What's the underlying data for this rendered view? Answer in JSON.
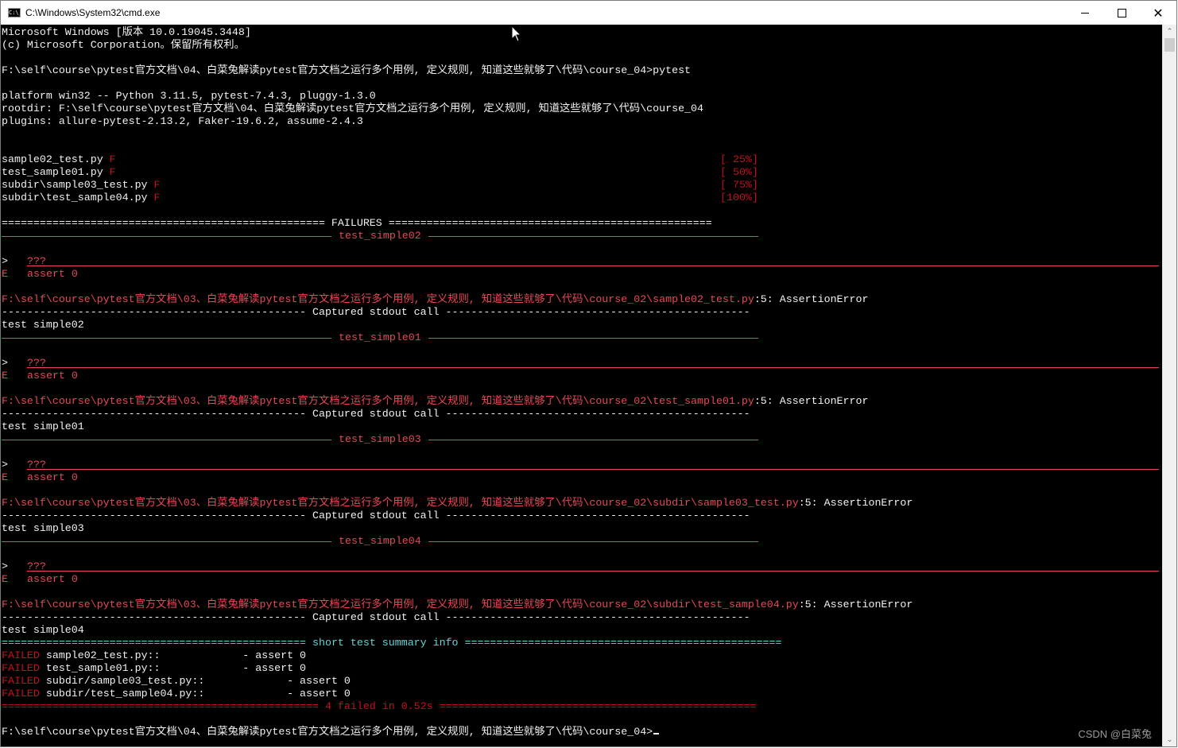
{
  "window": {
    "title": "C:\\Windows\\System32\\cmd.exe",
    "app_icon_text": "C:\\_",
    "controls": {
      "minimize": "minimize",
      "maximize": "maximize",
      "close": "✕"
    }
  },
  "console": {
    "header": [
      "Microsoft Windows [版本 10.0.19045.3448]",
      "(c) Microsoft Corporation。保留所有权利。"
    ],
    "prompt_command": "F:\\self\\course\\pytest官方文档\\04、白菜兔解读pytest官方文档之运行多个用例, 定义规则, 知道这些就够了\\代码\\course_04>pytest",
    "session_info": [
      "platform win32 -- Python 3.11.5, pytest-7.4.3, pluggy-1.3.0",
      "rootdir: F:\\self\\course\\pytest官方文档\\04、白菜兔解读pytest官方文档之运行多个用例, 定义规则, 知道这些就够了\\代码\\course_04",
      "plugins: allure-pytest-2.13.2, Faker-19.6.2, assume-2.4.3"
    ],
    "progress": [
      {
        "file": "sample02_test.py",
        "result": "F",
        "percent": "[ 25%]"
      },
      {
        "file": "test_sample01.py",
        "result": "F",
        "percent": "[ 50%]"
      },
      {
        "file": "subdir\\sample03_test.py",
        "result": "F",
        "percent": "[ 75%]"
      },
      {
        "file": "subdir\\test_sample04.py",
        "result": "F",
        "percent": "[100%]"
      }
    ],
    "failures_header": "=================================================== FAILURES ===================================================",
    "failures": [
      {
        "name": "test_simple02",
        "arrow": ">",
        "code": "???",
        "err_prefix": "E",
        "err": "assert 0",
        "location": "F:\\self\\course\\pytest官方文档\\03、白菜兔解读pytest官方文档之运行多个用例, 定义规则, 知道这些就够了\\代码\\course_02\\sample02_test.py",
        "location_suffix": ":5: AssertionError",
        "captured_header": "------------------------------------------------ Captured stdout call ------------------------------------------------",
        "stdout": "test simple02"
      },
      {
        "name": "test_simple01",
        "arrow": ">",
        "code": "???",
        "err_prefix": "E",
        "err": "assert 0",
        "location": "F:\\self\\course\\pytest官方文档\\03、白菜兔解读pytest官方文档之运行多个用例, 定义规则, 知道这些就够了\\代码\\course_02\\test_sample01.py",
        "location_suffix": ":5: AssertionError",
        "captured_header": "------------------------------------------------ Captured stdout call ------------------------------------------------",
        "stdout": "test simple01"
      },
      {
        "name": "test_simple03",
        "arrow": ">",
        "code": "???",
        "err_prefix": "E",
        "err": "assert 0",
        "location": "F:\\self\\course\\pytest官方文档\\03、白菜兔解读pytest官方文档之运行多个用例, 定义规则, 知道这些就够了\\代码\\course_02\\subdir\\sample03_test.py",
        "location_suffix": ":5: AssertionError",
        "captured_header": "------------------------------------------------ Captured stdout call ------------------------------------------------",
        "stdout": "test simple03"
      },
      {
        "name": "test_simple04",
        "arrow": ">",
        "code": "???",
        "err_prefix": "E",
        "err": "assert 0",
        "location": "F:\\self\\course\\pytest官方文档\\03、白菜兔解读pytest官方文档之运行多个用例, 定义规则, 知道这些就够了\\代码\\course_02\\subdir\\test_sample04.py",
        "location_suffix": ":5: AssertionError",
        "captured_header": "------------------------------------------------ Captured stdout call ------------------------------------------------",
        "stdout": "test simple04"
      }
    ],
    "summary_header_left": "================================================",
    "summary_header_title": "short test summary info",
    "summary_header_right": "==================================================",
    "summary": [
      {
        "status": "FAILED",
        "test": "sample02_test.py::             - assert 0"
      },
      {
        "status": "FAILED",
        "test": "test_sample01.py::             - assert 0"
      },
      {
        "status": "FAILED",
        "test": "subdir/sample03_test.py::             - assert 0"
      },
      {
        "status": "FAILED",
        "test": "subdir/test_sample04.py::             - assert 0"
      }
    ],
    "final_line": "================================================== 4 failed in 0.52s ==================================================",
    "final_prompt": "F:\\self\\course\\pytest官方文档\\04、白菜兔解读pytest官方文档之运行多个用例, 定义规则, 知道这些就够了\\代码\\course_04>"
  },
  "scrollbar": {
    "up": "⌃",
    "down": "⌄"
  },
  "watermark": "CSDN @白菜兔"
}
